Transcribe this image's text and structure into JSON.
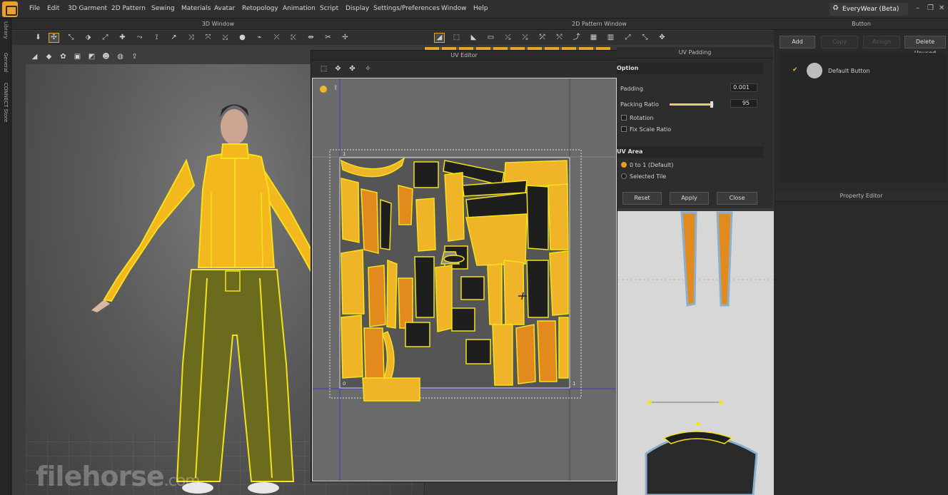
{
  "menubar": {
    "items": [
      "File",
      "Edit",
      "3D Garment",
      "2D Pattern",
      "Sewing",
      "Materials",
      "Avatar",
      "Retopology",
      "Animation",
      "Script",
      "Display",
      "Settings/Preferences",
      "Window",
      "Help"
    ],
    "product_label": "EveryWear (Beta)",
    "window_controls": [
      "–",
      "❐",
      "✕"
    ]
  },
  "left_strip": {
    "labels": [
      "Library",
      "General",
      "CONNECT Store"
    ]
  },
  "window_3d": {
    "title": "3D Window"
  },
  "window_2d": {
    "title": "2D Pattern Window"
  },
  "uv_editor": {
    "title": "UV Editor",
    "corner_0": "0",
    "corner_1": "1",
    "corner_top": "1"
  },
  "uv_padding": {
    "title": "UV Padding",
    "option_header": "Option",
    "padding_label": "Padding",
    "padding_value": "0.001",
    "packing_ratio_label": "Packing Ratio",
    "packing_ratio_value": "95",
    "packing_ratio_fraction": 0.95,
    "rotation_label": "Rotation",
    "fix_scale_label": "Fix Scale Ratio",
    "uv_area_header": "UV Area",
    "area_default_label": "0 to 1 (Default)",
    "area_selected_label": "Selected Tile",
    "reset_label": "Reset",
    "apply_label": "Apply",
    "close_label": "Close"
  },
  "button_panel": {
    "title": "Button",
    "add_label": "Add",
    "copy_label": "Copy",
    "assign_label": "Assign",
    "delete_label": "Delete Unused",
    "item_label": "Default Button"
  },
  "property_editor": {
    "title": "Property Editor"
  },
  "watermark": {
    "main": "filehorse",
    "suffix": ".com"
  },
  "colors": {
    "accent": "#f0b429",
    "garment_orange": "#e38a1e",
    "outline": "#f4e21a",
    "dark_patch": "#1e1e1e"
  }
}
